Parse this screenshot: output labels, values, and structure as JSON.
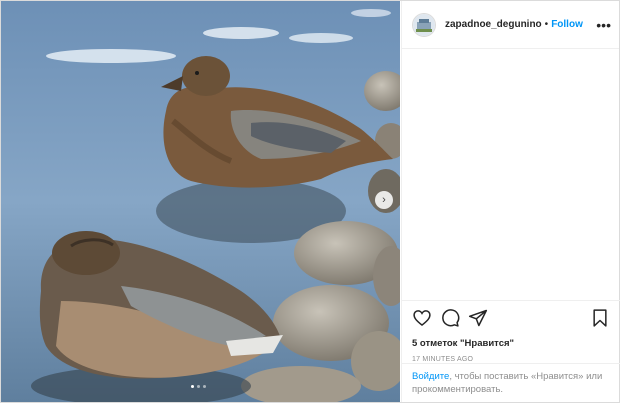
{
  "header": {
    "username": "zapadnoe_degunino",
    "separator": "•",
    "follow_label": "Follow",
    "more_label": "•••"
  },
  "media": {
    "description_icon": "ducks-photo",
    "carousel_next_label": "›",
    "carousel_pages": 3,
    "carousel_active": 0
  },
  "actions": {
    "icons": [
      "heart-icon",
      "comment-icon",
      "share-icon",
      "bookmark-icon"
    ]
  },
  "likes_text": "5 отметок \"Нравится\"",
  "timestamp": "17 MINUTES AGO",
  "login_prompt": {
    "link_label": "Войдите",
    "text": ", чтобы поставить «Нравится» или прокомментировать."
  },
  "colors": {
    "accent": "#0095f6",
    "text": "#262626",
    "muted": "#8e8e8e",
    "border": "#dbdbdb"
  }
}
